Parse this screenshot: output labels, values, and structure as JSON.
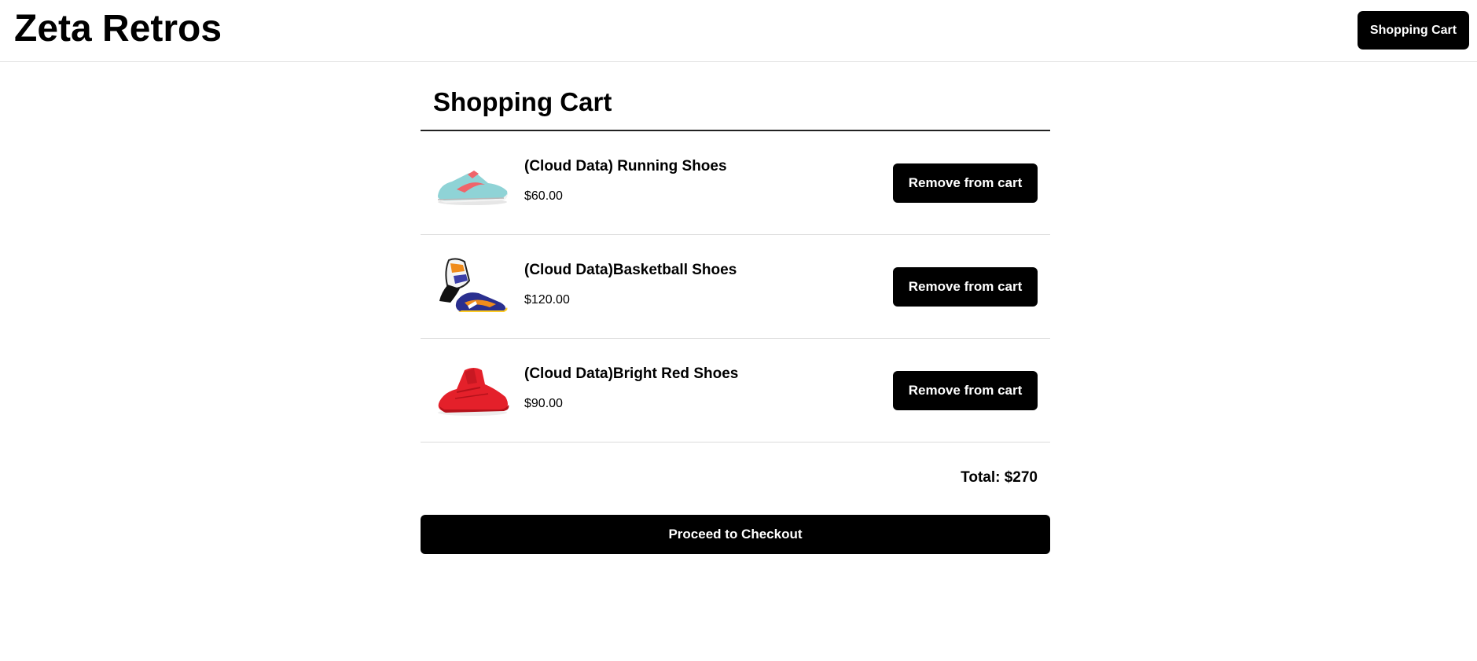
{
  "header": {
    "brand": "Zeta Retros",
    "cart_button_label": "Shopping Cart"
  },
  "cart": {
    "heading": "Shopping Cart",
    "items": [
      {
        "name": "(Cloud Data) Running Shoes",
        "price": "$60.00",
        "remove_label": "Remove from cart",
        "image_icon": "running-shoe-image",
        "image_color": "#8fd3d6",
        "accent_color": "#f0646a"
      },
      {
        "name": "(Cloud Data)Basketball Shoes",
        "price": "$120.00",
        "remove_label": "Remove from cart",
        "image_icon": "basketball-shoe-image",
        "image_color": "#2a2f8f",
        "accent_color": "#f08c1c"
      },
      {
        "name": "(Cloud Data)Bright Red Shoes",
        "price": "$90.00",
        "remove_label": "Remove from cart",
        "image_icon": "red-shoe-image",
        "image_color": "#e4202a",
        "accent_color": "#b5121b"
      }
    ],
    "total_text": "Total: $270",
    "checkout_label": "Proceed to Checkout"
  }
}
